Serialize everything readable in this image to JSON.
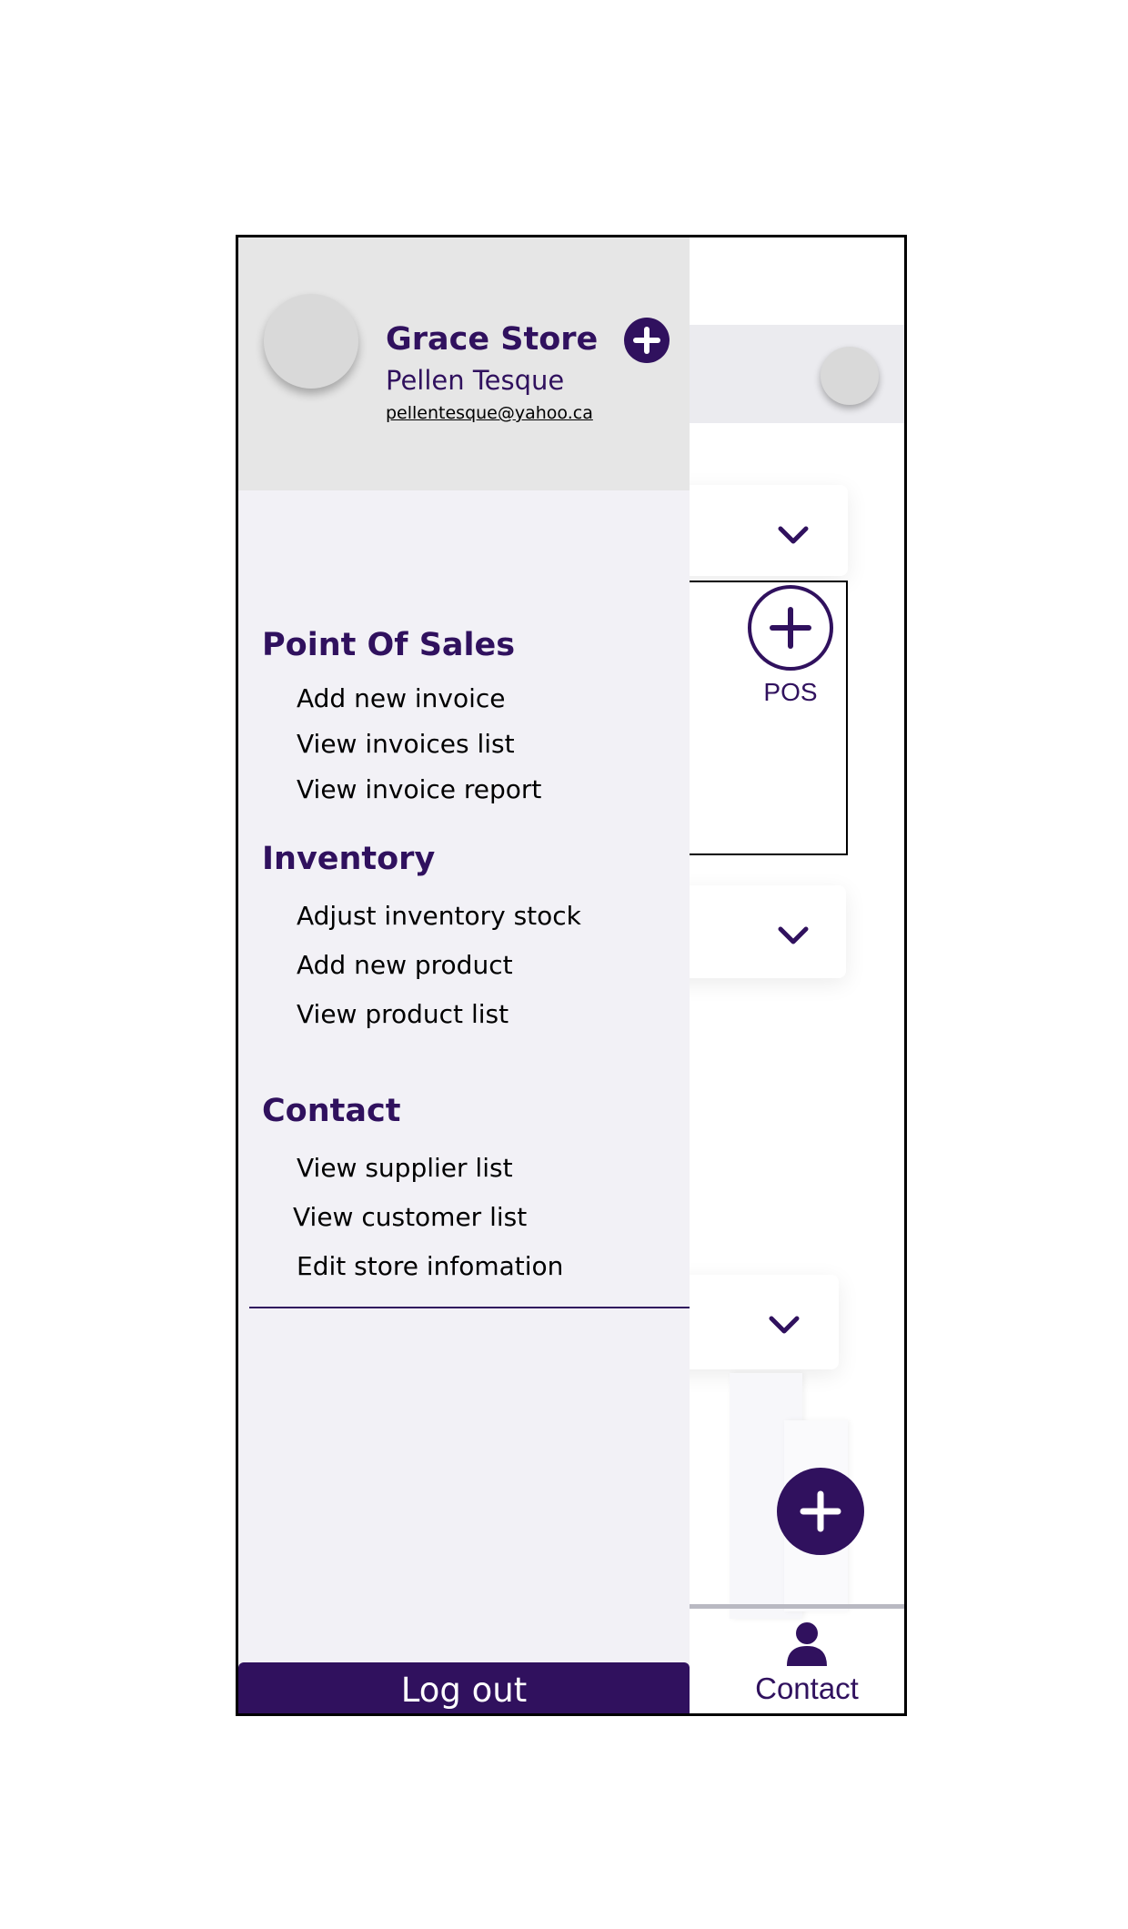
{
  "drawer": {
    "store_name": "Grace Store",
    "owner_name": "Pellen Tesque",
    "email": "pellentesque@yahoo.ca",
    "sections": [
      {
        "title": "Point Of Sales",
        "items": [
          "Add new invoice",
          "View invoices list",
          "View invoice  report"
        ]
      },
      {
        "title": "Inventory",
        "items": [
          "Adjust inventory stock",
          "Add new product",
          "View product list"
        ]
      },
      {
        "title": "Contact",
        "items": [
          "View supplier list",
          "View customer list",
          "Edit store infomation"
        ]
      }
    ],
    "logout_label": "Log out"
  },
  "background": {
    "pos_label": "POS",
    "bottom_nav": {
      "contact_label": "Contact"
    }
  },
  "colors": {
    "brand": "#30115e",
    "drawer_bg": "#f2f1f6",
    "drawer_header_bg": "#e6e6e6"
  },
  "icons": [
    "plus-circle-icon",
    "chevron-down-icon",
    "plus-icon",
    "person-icon"
  ]
}
